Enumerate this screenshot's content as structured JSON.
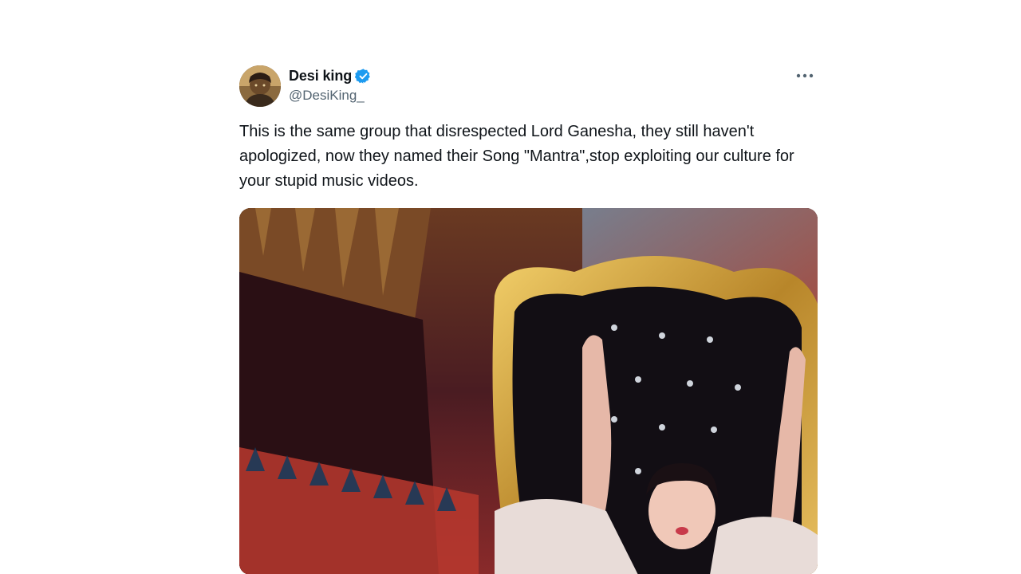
{
  "tweet": {
    "author": {
      "display_name": "Desi king",
      "handle": "@DesiKing_",
      "verified": true,
      "avatar_icon": "avatar-image"
    },
    "more_icon": "more-options-icon",
    "text": "This is the same group that disrespected Lord Ganesha, they still haven't apologized, now they named their Song \"Mantra\",stop exploiting our culture for your stupid music videos.",
    "media": {
      "type": "image"
    }
  },
  "colors": {
    "text_primary": "#0f1419",
    "text_secondary": "#536471",
    "verified_blue": "#1d9bf0",
    "background": "#ffffff"
  }
}
